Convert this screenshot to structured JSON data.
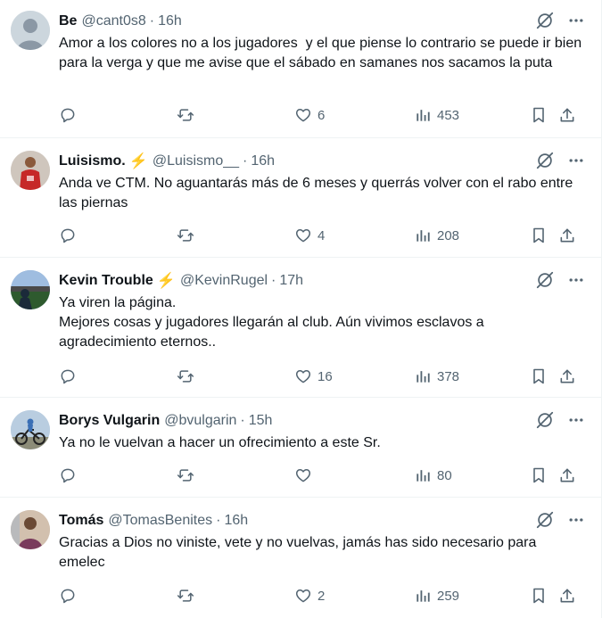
{
  "tweets": [
    {
      "name": "Be",
      "verified_bolt": false,
      "handle": "@cant0s8",
      "time": "16h",
      "text": "Amor a los colores no a los jugadores  y el que piense lo contrario se puede ir bien para la verga y que me avise que el sábado en samanes nos sacamos la puta",
      "likes": "6",
      "views": "453",
      "avatar": "default-avatar"
    },
    {
      "name": "Luisismo.",
      "verified_bolt": true,
      "handle": "@Luisismo__",
      "time": "16h",
      "text": "Anda ve CTM. No aguantarás más de 6 meses y querrás volver con el rabo entre las piernas",
      "likes": "4",
      "views": "208",
      "avatar": "red-jersey-photo"
    },
    {
      "name": "Kevin Trouble",
      "verified_bolt": true,
      "handle": "@KevinRugel",
      "time": "17h",
      "text": "Ya viren la página.\nMejores cosas y jugadores llegarán al club. Aún vivimos esclavos a agradecimiento eternos..",
      "likes": "16",
      "views": "378",
      "avatar": "stadium-photo"
    },
    {
      "name": "Borys Vulgarin",
      "verified_bolt": false,
      "handle": "@bvulgarin",
      "time": "15h",
      "text": "Ya no le vuelvan a hacer un ofrecimiento a este Sr.",
      "likes": "",
      "views": "80",
      "avatar": "cyclist-photo"
    },
    {
      "name": "Tomás",
      "verified_bolt": false,
      "handle": "@TomasBenites",
      "time": "16h",
      "text": "Gracias a Dios no viniste, vete y no vuelvas, jamás has sido necesario para emelec",
      "likes": "2",
      "views": "259",
      "avatar": "person-photo"
    }
  ],
  "separator": "·",
  "bolt_glyph": "⚡",
  "colors": {
    "text": "#0f1419",
    "secondary": "#536471",
    "divider": "#eff3f4",
    "bolt": "#f4a100"
  }
}
